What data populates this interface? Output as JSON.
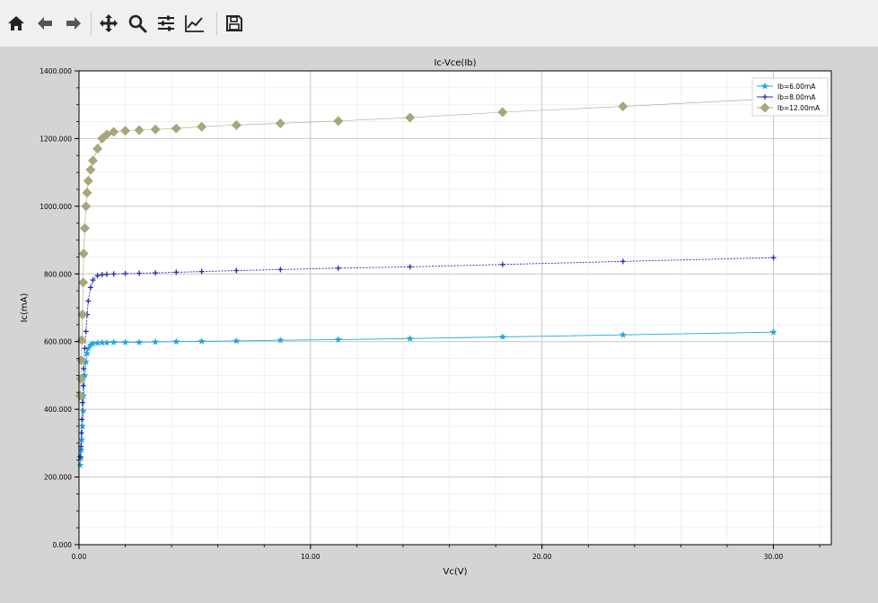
{
  "toolbar": {
    "buttons": [
      {
        "name": "home-button",
        "icon": "home-icon"
      },
      {
        "name": "back-button",
        "icon": "arrow-left-icon"
      },
      {
        "name": "forward-button",
        "icon": "arrow-right-icon"
      },
      {
        "name": "pan-button",
        "icon": "move-icon"
      },
      {
        "name": "zoom-button",
        "icon": "zoom-icon"
      },
      {
        "name": "configure-subplots-button",
        "icon": "sliders-icon"
      },
      {
        "name": "edit-axes-button",
        "icon": "line-chart-icon"
      },
      {
        "name": "save-button",
        "icon": "floppy-disk-icon"
      }
    ]
  },
  "chart_data": {
    "type": "line",
    "title": "Ic-Vce(Ib)",
    "xlabel": "Vc(V)",
    "ylabel": "Ic(mA)",
    "xlim": [
      0,
      32.5
    ],
    "ylim": [
      0,
      1400
    ],
    "xticks": [
      0,
      10,
      20,
      30
    ],
    "xtick_labels": [
      "0.00",
      "10.00",
      "20.00",
      "30.00"
    ],
    "yticks": [
      0,
      200,
      400,
      600,
      800,
      1000,
      1200,
      1400
    ],
    "ytick_labels": [
      "0.000",
      "200.000",
      "400.000",
      "600.000",
      "800.000",
      "1000.000",
      "1200.000",
      "1400.000"
    ],
    "grid": true,
    "legend_position": "top-right",
    "series": [
      {
        "name": "Ib=6.00mA",
        "color": "#1ea8d8",
        "marker": "star",
        "x": [
          0.05,
          0.08,
          0.1,
          0.12,
          0.15,
          0.18,
          0.2,
          0.25,
          0.3,
          0.35,
          0.4,
          0.5,
          0.6,
          0.8,
          1.0,
          1.2,
          1.5,
          2.0,
          2.6,
          3.3,
          4.2,
          5.3,
          6.8,
          8.7,
          11.2,
          14.3,
          18.3,
          23.5,
          30.0
        ],
        "y": [
          235,
          255,
          280,
          310,
          350,
          395,
          440,
          500,
          540,
          565,
          580,
          590,
          594,
          596,
          597,
          597,
          598,
          598,
          598,
          599,
          600,
          601,
          602,
          604,
          606,
          609,
          614,
          620,
          628
        ]
      },
      {
        "name": "Ib=8.00mA",
        "color": "#2a2ab4",
        "marker": "plus",
        "x": [
          0.05,
          0.08,
          0.1,
          0.12,
          0.15,
          0.18,
          0.2,
          0.25,
          0.3,
          0.35,
          0.4,
          0.5,
          0.6,
          0.8,
          1.0,
          1.2,
          1.5,
          2.0,
          2.6,
          3.3,
          4.2,
          5.3,
          6.8,
          8.7,
          11.2,
          14.3,
          18.3,
          23.5,
          30.0
        ],
        "y": [
          260,
          290,
          330,
          370,
          420,
          470,
          520,
          580,
          630,
          680,
          720,
          760,
          782,
          795,
          798,
          799,
          800,
          801,
          802,
          803,
          805,
          807,
          810,
          813,
          817,
          821,
          828,
          837,
          848
        ]
      },
      {
        "name": "Ib=12.00mA",
        "color": "#a8a67a",
        "marker": "diamond",
        "x": [
          0.05,
          0.08,
          0.1,
          0.12,
          0.15,
          0.18,
          0.2,
          0.25,
          0.3,
          0.35,
          0.4,
          0.5,
          0.6,
          0.8,
          1.0,
          1.2,
          1.5,
          2.0,
          2.6,
          3.3,
          4.2,
          5.3,
          6.8,
          8.7,
          11.2,
          14.3,
          18.3,
          23.5,
          30.0
        ],
        "y": [
          440,
          490,
          545,
          605,
          680,
          775,
          860,
          935,
          1000,
          1040,
          1075,
          1108,
          1135,
          1170,
          1200,
          1212,
          1220,
          1223,
          1225,
          1227,
          1230,
          1235,
          1240,
          1245,
          1252,
          1262,
          1278,
          1295,
          1318
        ]
      }
    ]
  }
}
